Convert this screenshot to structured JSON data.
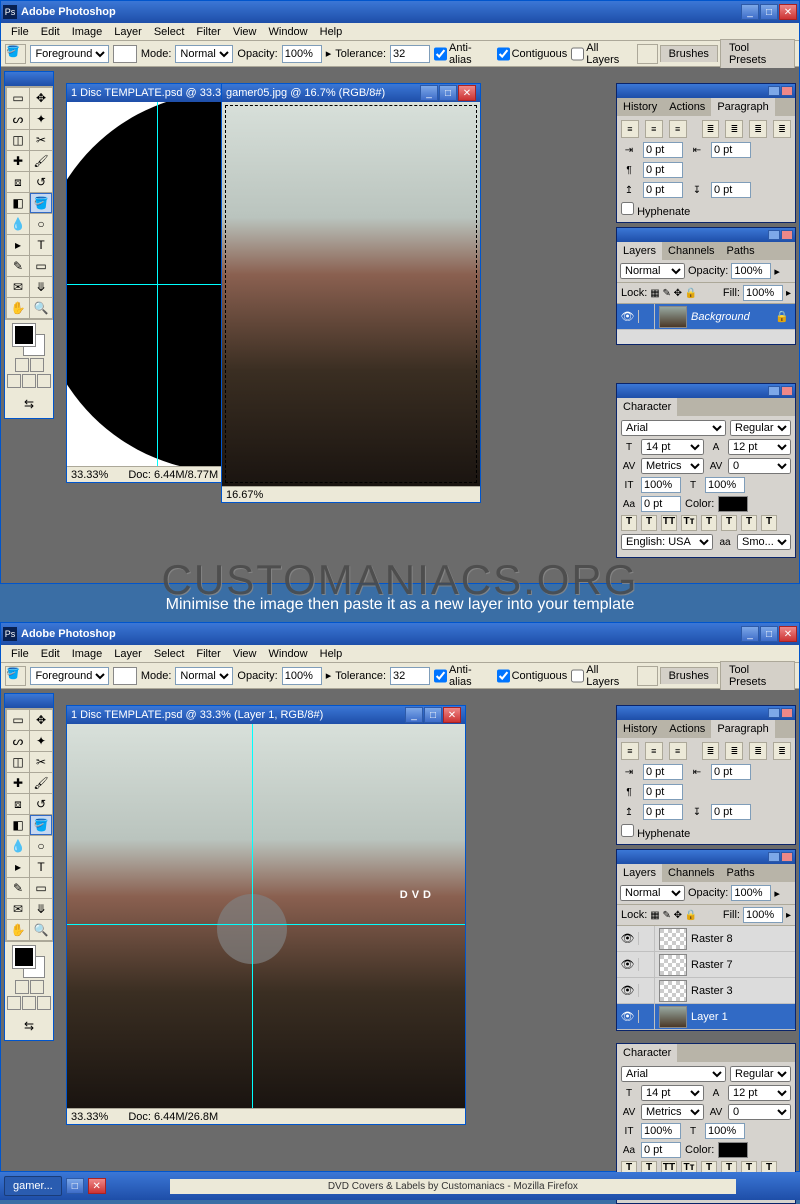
{
  "app": "Adobe Photoshop",
  "menu": [
    "File",
    "Edit",
    "Image",
    "Layer",
    "Select",
    "Filter",
    "View",
    "Window",
    "Help"
  ],
  "opt": {
    "fill": "Foreground",
    "mode_label": "Mode:",
    "mode": "Normal",
    "opacity_label": "Opacity:",
    "opacity": "100%",
    "tol_label": "Tolerance:",
    "tol": "32",
    "aa": "Anti-alias",
    "contig": "Contiguous",
    "all": "All Layers",
    "tabs": [
      "Brushes",
      "Tool Presets"
    ]
  },
  "doc1": {
    "title": "1 Disc TEMPLATE.psd @ 33.3",
    "zoom": "33.33%",
    "docinfo": "Doc: 6.44M/8.77M"
  },
  "doc2": {
    "title": "gamer05.jpg @ 16.7% (RGB/8#)",
    "zoom": "16.67%"
  },
  "doc3": {
    "title": "1 Disc TEMPLATE.psd @ 33.3% (Layer 1, RGB/8#)",
    "zoom": "33.33%",
    "docinfo": "Doc: 6.44M/26.8M"
  },
  "paragraph": {
    "title": "Paragraph",
    "tabs": [
      "History",
      "Actions",
      "Paragraph"
    ],
    "v1": "0 pt",
    "v2": "0 pt",
    "v3": "0 pt",
    "v4": "0 pt",
    "v5": "0 pt",
    "hyphen": "Hyphenate"
  },
  "layers1": {
    "title": "Layers",
    "tabs": [
      "Layers",
      "Channels",
      "Paths"
    ],
    "blend": "Normal",
    "opac_l": "Opacity:",
    "opac": "100%",
    "lock": "Lock:",
    "fill_l": "Fill:",
    "fill": "100%",
    "items": [
      {
        "name": "Background"
      }
    ]
  },
  "layers2": {
    "title": "Layers",
    "tabs": [
      "Layers",
      "Channels",
      "Paths"
    ],
    "blend": "Normal",
    "opac_l": "Opacity:",
    "opac": "100%",
    "lock": "Lock:",
    "fill_l": "Fill:",
    "fill": "100%",
    "items": [
      {
        "name": "Raster 8"
      },
      {
        "name": "Raster 7"
      },
      {
        "name": "Raster 3"
      },
      {
        "name": "Layer 1"
      }
    ]
  },
  "char": {
    "title": "Character",
    "font": "Arial",
    "style": "Regular",
    "size": "14 pt",
    "leading": "12 pt",
    "metrics": "Metrics",
    "track": "0",
    "vscale": "100%",
    "hscale": "100%",
    "baseline": "0 pt",
    "color_l": "Color:",
    "lang": "English: USA",
    "aa": "Smo..."
  },
  "caption": "Minimise the image then paste it as a new layer into your template",
  "watermark": "CUSTOMANIACS.ORG",
  "taskbar": {
    "item": "gamer...",
    "status": "DVD Covers & Labels by Customaniacs - Mozilla Firefox"
  }
}
